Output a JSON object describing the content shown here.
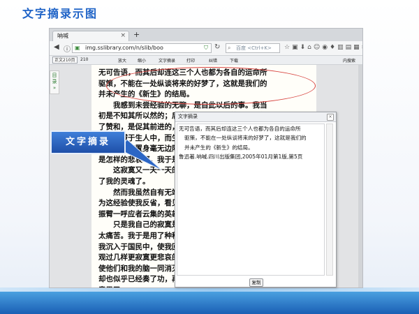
{
  "slide": {
    "title": "文字摘录示图",
    "callout_label": "文字摘录"
  },
  "browser": {
    "tab_title": "呐喊",
    "tab_close": "×",
    "new_tab": "+",
    "url": "img.sslibrary.com/n/slib/boo",
    "search_placeholder": "百度 <Ctrl+K>"
  },
  "reader_toolbar": {
    "page_select": "正文210页",
    "page_counter": "210",
    "zoom_in": "放大",
    "zoom_out": "缩小",
    "text_extract": "文字摘录",
    "print": "打印",
    "error_correct": "纠错",
    "download": "下载",
    "internal_search": "内搜索",
    "toc_label": "目录"
  },
  "page_text": {
    "lines": [
      "无可告语，而其后却连这三个人也都为各自的运命所",
      "驱策，不能在一处纵谈将来的好梦了，这就是我们的",
      "并未产生的《新生》的结局。",
      "　　我感到未尝经验的无聊，是自此以后的事。我当",
      "初是不知其所以然的；后来想，凡有一人的主张，得",
      "了赞和，是促其前进的，得了反对，是促其奋斗的，",
      "独有叫喊于生人中，而生人并无反应，既非赞同，也",
      "无反对，如置身毫无边际的荒原，无可措手的了，这",
      "是怎样的悲哀呵，我于是以我所感到者为寂寞。",
      "　　这寂寞又一天一天的长大起来，如大毒蛇，缠住",
      "了我的灵魂了。",
      "　　然而我虽然自有无端的悲哀，却也并不愤懑，因",
      "为这经验使我反省，看见自己了：就是我决不是一个",
      "振臂一呼应者云集的英雄。",
      "　　只是我自己的寂寞是不可不驱除的，因为这于我",
      "太痛苦。我于是用了种种法，来麻醉自己的灵魂，使",
      "我沉入于国民中，使我回到古代去，后来也亲历或旁",
      "观过几样更寂寞更悲哀的事，都为我所不愿追怀，甘",
      "使他们和我的脑一同消灭在泥土里的，但我的麻醉法",
      "却也似乎已经奏了功，再没有青年时候的慷慨激昂的",
      "意思了。"
    ]
  },
  "dialog": {
    "title": "文字摘录",
    "close": "×",
    "lines": [
      "无可告语，而其后却连这三个人也都为各自的运命所",
      "驱策，不能在一处纵谈将来的好梦了，这就是我们的",
      "并未产生的《新生》的结局。",
      "鲁迅著.呐喊.四川出版集团,2005年01月第1版,第5页"
    ],
    "copy_button": "复制"
  },
  "colors": {
    "title": "#1f63c7",
    "ellipse": "#d7413d",
    "callout": "#2c66c4",
    "band": "#1a5fb4"
  },
  "icons": [
    "back-icon",
    "info-icon",
    "lock-icon",
    "shield-icon",
    "reload-icon",
    "search-icon",
    "bookmark-star-icon",
    "menu-icon"
  ]
}
